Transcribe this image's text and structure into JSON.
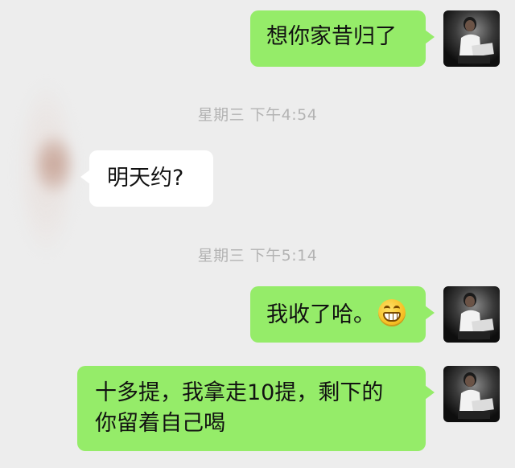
{
  "messages": [
    {
      "side": "right",
      "text": "想你家昔归了"
    },
    {
      "timestamp": "星期三 下午4:54"
    },
    {
      "side": "left",
      "text": "明天约?"
    },
    {
      "timestamp": "星期三 下午5:14"
    },
    {
      "side": "right",
      "text": "我收了哈。",
      "emoji": "grinning-face-emoji"
    },
    {
      "side": "right",
      "lines": [
        "十多提，我拿走10提，剩下的",
        "你留着自己喝"
      ]
    }
  ],
  "colors": {
    "background": "#ededed",
    "outgoing_bubble": "#95ec69",
    "incoming_bubble": "#ffffff",
    "timestamp_text": "#b3b3b3"
  },
  "icons": {
    "self_avatar": "person-reading-photo-avatar",
    "contact_avatar": "blurred-contact-avatar"
  }
}
